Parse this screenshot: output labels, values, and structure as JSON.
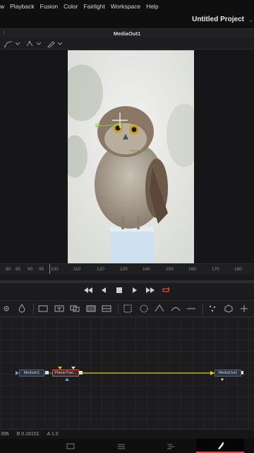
{
  "menubar": {
    "items": [
      "w",
      "Playback",
      "Fusion",
      "Color",
      "Fairlight",
      "Workspace",
      "Help"
    ]
  },
  "titlebar": {
    "project_name": "Untitled Project",
    "dropdown_icon": "chevron-down-icon"
  },
  "viewer": {
    "title": "MediaOut1",
    "tools": [
      "spline-icon",
      "chevron-down-icon",
      "transform-icon",
      "chevron-down-icon",
      "pen-icon",
      "chevron-down-icon"
    ]
  },
  "ruler": {
    "ticks": [
      "80",
      "85",
      "90",
      "95",
      "100",
      "110",
      "120",
      "130",
      "140",
      "150",
      "160",
      "170",
      "180"
    ]
  },
  "transport": {
    "buttons": [
      "skip-to-start-icon",
      "play-reverse-icon",
      "stop-icon",
      "play-icon",
      "skip-to-end-icon",
      "loop-icon"
    ]
  },
  "node_editor": {
    "nodes": [
      {
        "id": "mediain",
        "label": "MediaIn1"
      },
      {
        "id": "planar",
        "label": "PlanarTrac..."
      },
      {
        "id": "mediaout",
        "label": "MediaOut1"
      }
    ],
    "colors": {
      "link": "#e6c21a",
      "mediain_link": "#8a8a8a",
      "tracker_border": "#d1584f"
    }
  },
  "statusbar": {
    "g_value": "396",
    "b_value": "B 0.16151",
    "a_value": "A 1.0"
  },
  "pages": {
    "items": [
      "media-icon",
      "cut-icon",
      "edit-icon",
      "fusion-icon"
    ],
    "active": "fusion-icon",
    "accent": "#e14b3b"
  }
}
